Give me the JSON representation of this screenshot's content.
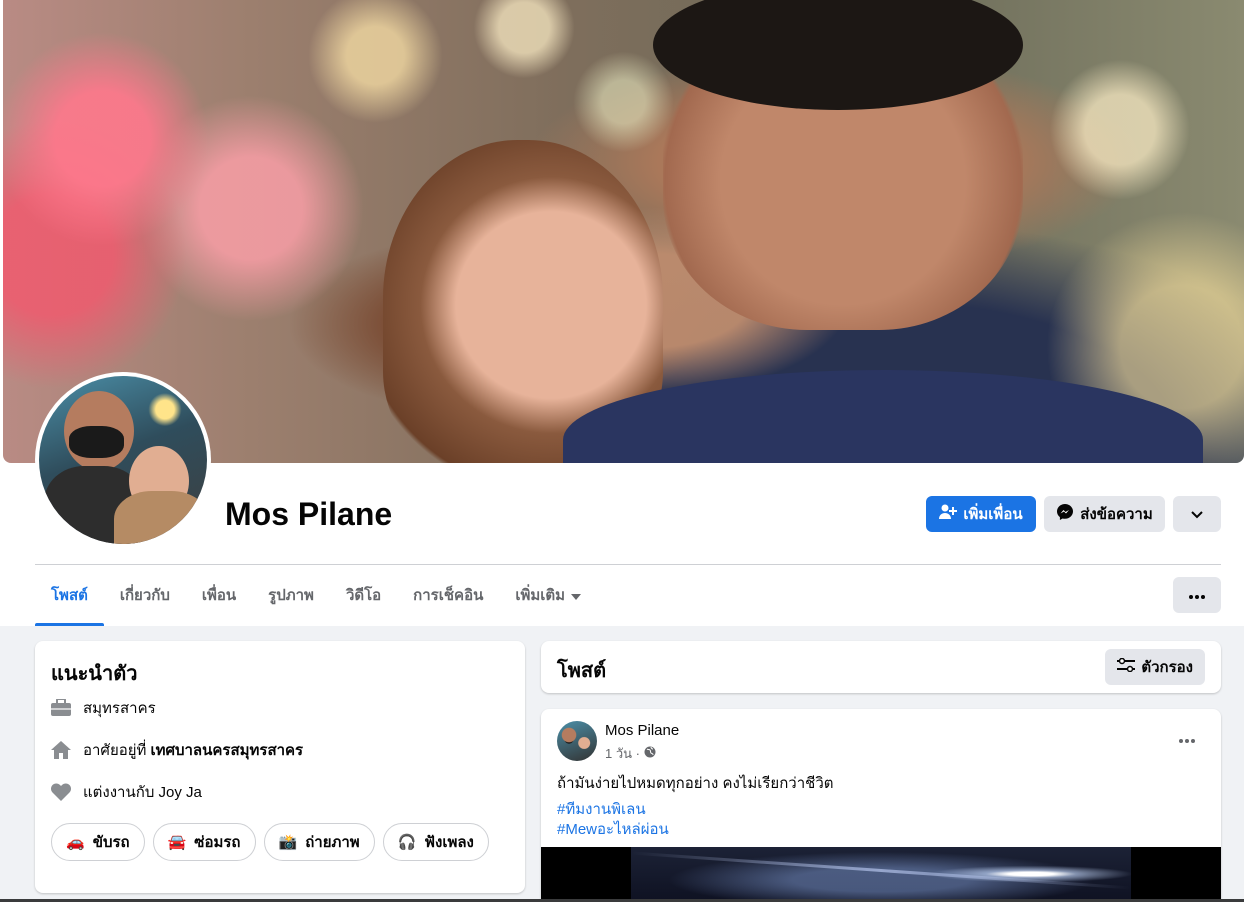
{
  "profile": {
    "name": "Mos Pilane"
  },
  "actions": {
    "add_friend": "เพิ่มเพื่อน",
    "message": "ส่งข้อความ",
    "more_icon": "chevron-down-icon"
  },
  "tabs": [
    {
      "label": "โพสต์",
      "active": true
    },
    {
      "label": "เกี่ยวกับ"
    },
    {
      "label": "เพื่อน"
    },
    {
      "label": "รูปภาพ"
    },
    {
      "label": "วิดีโอ"
    },
    {
      "label": "การเช็คอิน"
    },
    {
      "label": "เพิ่มเติม"
    }
  ],
  "intro": {
    "title": "แนะนำตัว",
    "work": "สมุทรสาคร",
    "lives_prefix": "อาศัยอยู่ที่",
    "lives_place": "เทศบาลนครสมุทรสาคร",
    "relationship": "แต่งงานกับ Joy Ja",
    "hobbies": [
      {
        "emoji": "🚗",
        "label": "ขับรถ"
      },
      {
        "emoji": "🚘",
        "label": "ซ่อมรถ"
      },
      {
        "emoji": "📸",
        "label": "ถ่ายภาพ"
      },
      {
        "emoji": "🎧",
        "label": "ฟังเพลง"
      }
    ]
  },
  "posts_header": {
    "title": "โพสต์",
    "filter": "ตัวกรอง"
  },
  "post": {
    "author": "Mos Pilane",
    "time": "1 วัน ·",
    "text": "ถ้ามันง่ายไปหมดทุกอย่าง คงไม่เรียกว่าชีวิต",
    "hashtags": [
      "#ทีมงานพิเลน",
      "#Mewอะไหล่ผ่อน"
    ]
  },
  "colors": {
    "accent": "#1b74e4",
    "secondary_button": "#e4e6eb",
    "page_bg": "#f0f2f5"
  }
}
